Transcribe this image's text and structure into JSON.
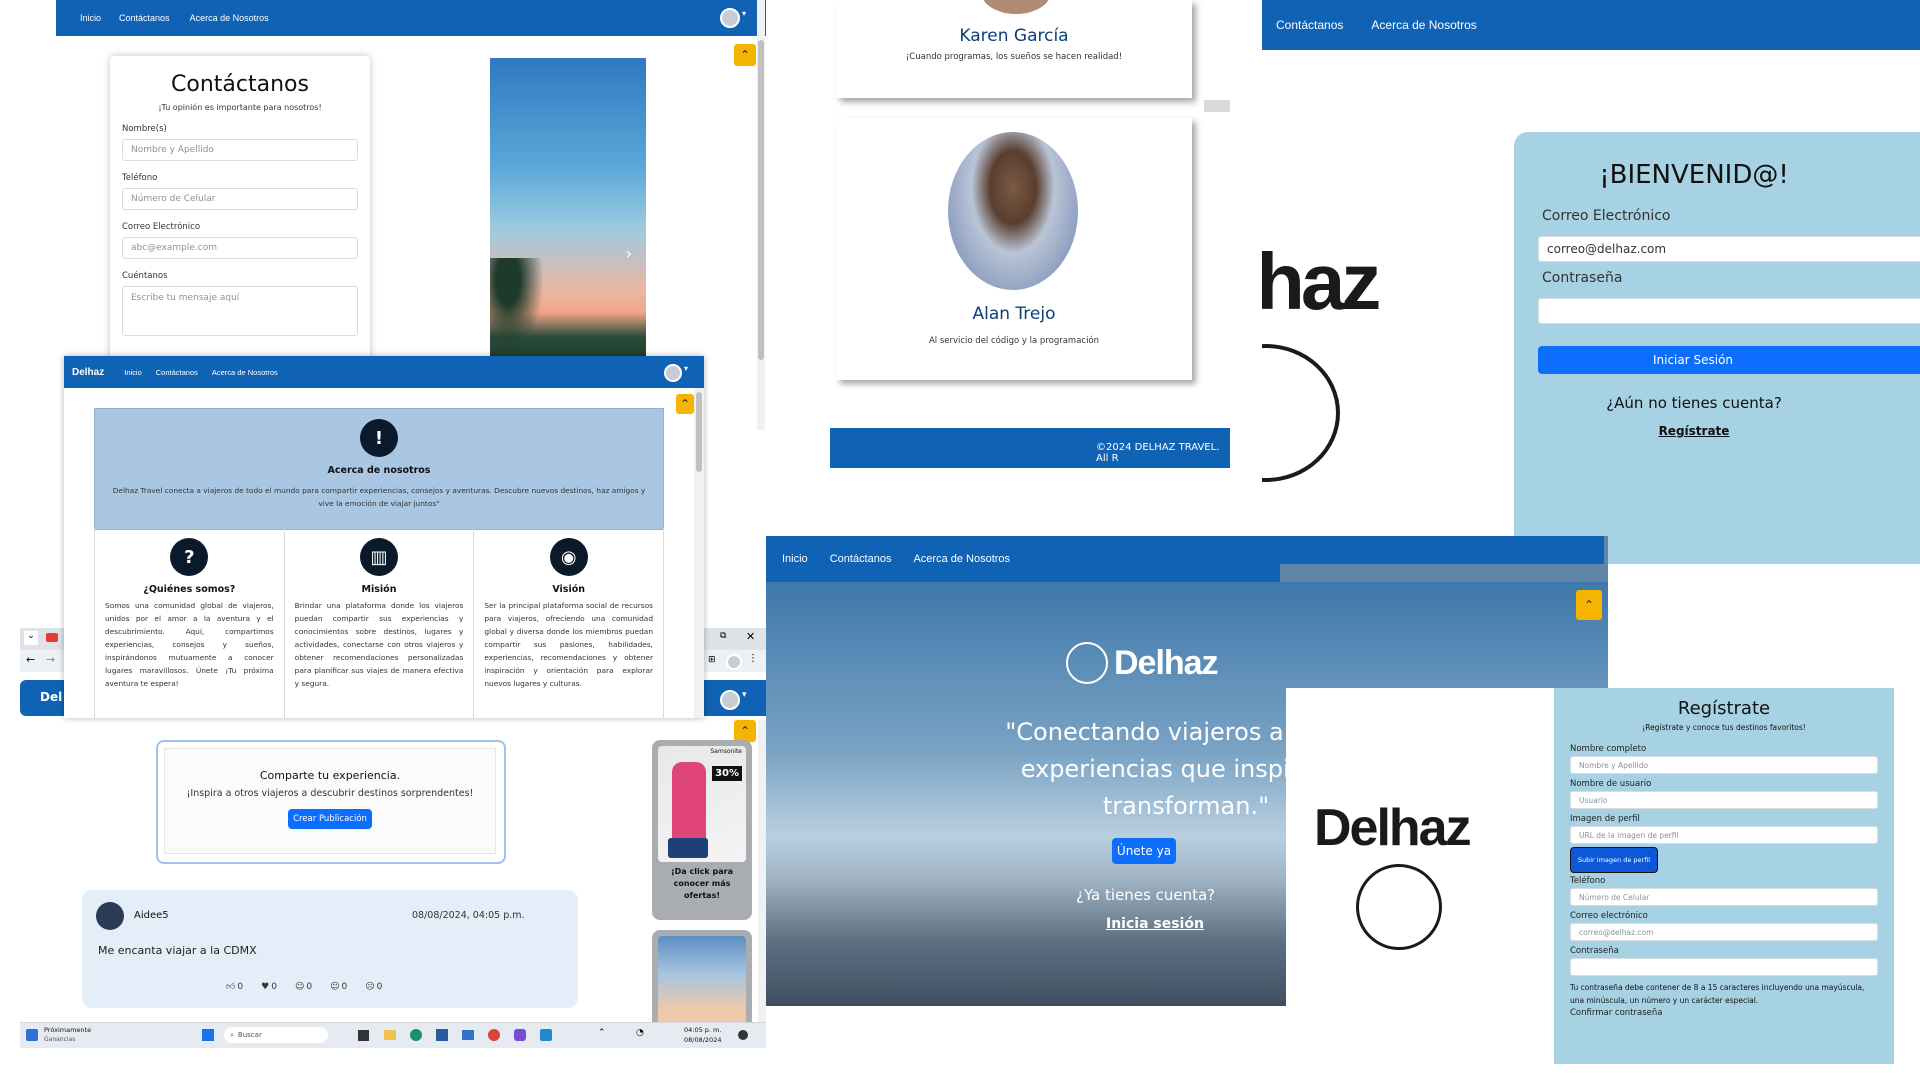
{
  "colors": {
    "primary_nav": "#0f62b4",
    "accent_yellow": "#f5b400",
    "about_bg": "#a9c7e2",
    "login_bg": "#a6d2e4",
    "register_bg": "#a6d2e4",
    "button_blue": "#0d6efd"
  },
  "contact_panel": {
    "nav": {
      "home": "Inicio",
      "contact": "Contáctanos",
      "about": "Acerca de Nosotros"
    },
    "title": "Contáctanos",
    "subtitle": "¡Tu opinión es importante para nosotros!",
    "fields": [
      {
        "label": "Nombre(s)",
        "placeholder": "Nombre y Apellido"
      },
      {
        "label": "Teléfono",
        "placeholder": "Número de Celular"
      },
      {
        "label": "Correo Electrónico",
        "placeholder": "abc@example.com"
      },
      {
        "label": "Cuéntanos",
        "placeholder": "Escribe tu mensaje aquí"
      }
    ]
  },
  "about_panel": {
    "nav": {
      "brand": "Delhaz",
      "home": "Inicio",
      "contact": "Contáctanos",
      "about": "Acerca de Nosotros"
    },
    "title": "Acerca de nosotros",
    "text": "Delhaz Travel conecta a viajeros de todo el mundo para compartir experiencias, consejos y aventuras. Descubre nuevos destinos, haz amigos y vive la emoción de viajar juntos\"",
    "columns": [
      {
        "icon": "question-icon",
        "title": "¿Quiénes somos?",
        "text": "Somos una comunidad global de viajeros, unidos por el amor a la aventura y el descubrimiento. Aquí, compartimos experiencias, consejos y sueños, inspirándonos mutuamente a conocer lugares maravillosos. Únete ¡Tu próxima aventura te espera!"
      },
      {
        "icon": "book-icon",
        "title": "Misión",
        "text": "Brindar una plataforma donde los viajeros puedan compartir sus experiencias y conocimientos sobre destinos, lugares y actividades, conectarse con otros viajeros y obtener recomendaciones personalizadas para planificar sus viajes de manera efectiva y segura."
      },
      {
        "icon": "eye-icon",
        "title": "Visión",
        "text": "Ser la principal plataforma social de recursos para viajeros, ofreciendo una comunidad global y diversa donde los miembros puedan compartir sus pasiones, habilidades, experiencias, recomendaciones y obtener inspiración y orientación para explorar nuevos lugares y culturas."
      }
    ]
  },
  "feed_panel": {
    "share_title": "Comparte tu experiencia.",
    "share_sub": "¡Inspira a otros viajeros a descubrir destinos sorprendentes!",
    "create_button": "Crear Publicación",
    "post": {
      "user": "Aidee5",
      "date": "08/08/2024, 04:05 p.m.",
      "text": "Me encanta viajar a la CDMX",
      "reactions": [
        "0",
        "0",
        "0",
        "0",
        "0"
      ]
    },
    "ad": {
      "brand": "Samsonite",
      "badge": "30%",
      "cta": "¡Da click para conocer más ofertas!"
    },
    "brand_partial": "Del"
  },
  "taskbar": {
    "weather_title": "Próximamente",
    "weather_sub": "Ganancias",
    "search": "Buscar",
    "time": "04:05 p. m.",
    "date": "08/08/2024"
  },
  "team_panel": {
    "members": [
      {
        "name": "Karen García",
        "quote": "¡Cuando programas, los sueños se hacen realidad!"
      },
      {
        "name": "Alan Trejo",
        "quote": "Al servicio del código y la programación"
      }
    ],
    "footer": "©2024 DELHAZ TRAVEL. All R"
  },
  "login_panel": {
    "nav": {
      "contact": "Contáctanos",
      "about": "Acerca de Nosotros"
    },
    "logo_partial": "haz",
    "title": "¡BIENVENID@!",
    "email_label": "Correo Electrónico",
    "email_value": "correo@delhaz.com",
    "password_label": "Contraseña",
    "login_button": "Iniciar Sesión",
    "no_account": "¿Aún no tienes cuenta?",
    "register_link": "Regístrate"
  },
  "landing_panel": {
    "nav": {
      "home": "Inicio",
      "contact": "Contáctanos",
      "about": "Acerca de Nosotros"
    },
    "brand": "Delhaz",
    "quote_line1": "\"Conectando viajeros a través",
    "quote_line2": "experiencias que inspiran y",
    "quote_line3": "transforman.\"",
    "join_button": "Únete ya",
    "have_account": "¿Ya tienes cuenta?",
    "login_link": "Inicia sesión"
  },
  "register_panel": {
    "brand": "Delhaz",
    "title": "Regístrate",
    "subtitle": "¡Regístrate y conoce tus destinos favoritos!",
    "fields": [
      {
        "label": "Nombre completo",
        "placeholder": "Nombre y Apellido"
      },
      {
        "label": "Nombre de usuario",
        "placeholder": "Usuario"
      },
      {
        "label": "Imagen de perfil",
        "placeholder": "URL de la imagen de perfil"
      }
    ],
    "upload_button": "Subir imagen de perfil",
    "fields2": [
      {
        "label": "Teléfono",
        "placeholder": "Número de Celular"
      },
      {
        "label": "Correo electrónico",
        "placeholder": "correo@delhaz.com"
      },
      {
        "label": "Contraseña",
        "placeholder": ""
      }
    ],
    "password_hint": "Tu contraseña debe contener de 8 a 15 caracteres incluyendo una mayúscula, una minúscula, un número y un carácter especial.",
    "confirm_label": "Confirmar contraseña"
  }
}
